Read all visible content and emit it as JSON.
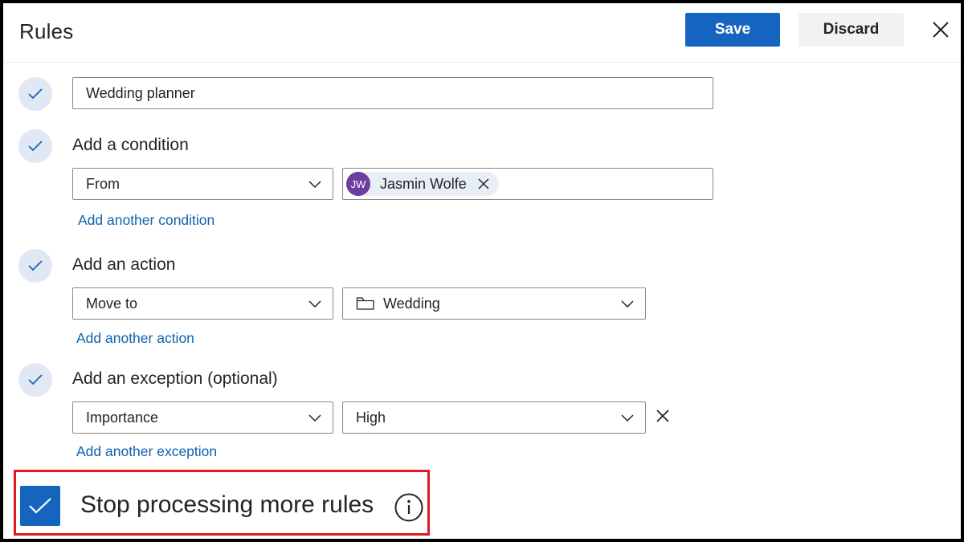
{
  "header": {
    "title": "Rules",
    "save_label": "Save",
    "discard_label": "Discard",
    "close_icon": "close-icon"
  },
  "rule_name": {
    "value": "Wedding planner"
  },
  "condition": {
    "label": "Add a condition",
    "type_value": "From",
    "persona_initials": "JW",
    "persona_name": "Jasmin Wolfe",
    "add_link": "Add another condition"
  },
  "action": {
    "label": "Add an action",
    "type_value": "Move to",
    "folder_value": "Wedding",
    "add_link": "Add another action"
  },
  "exception": {
    "label": "Add an exception (optional)",
    "type_value": "Importance",
    "value": "High",
    "add_link": "Add another exception"
  },
  "stop_processing": {
    "label": "Stop processing more rules",
    "checked": true
  },
  "colors": {
    "accent": "#1565c0",
    "link": "#0f62b0",
    "highlight": "#e0171c",
    "avatar": "#6b3fa0"
  }
}
